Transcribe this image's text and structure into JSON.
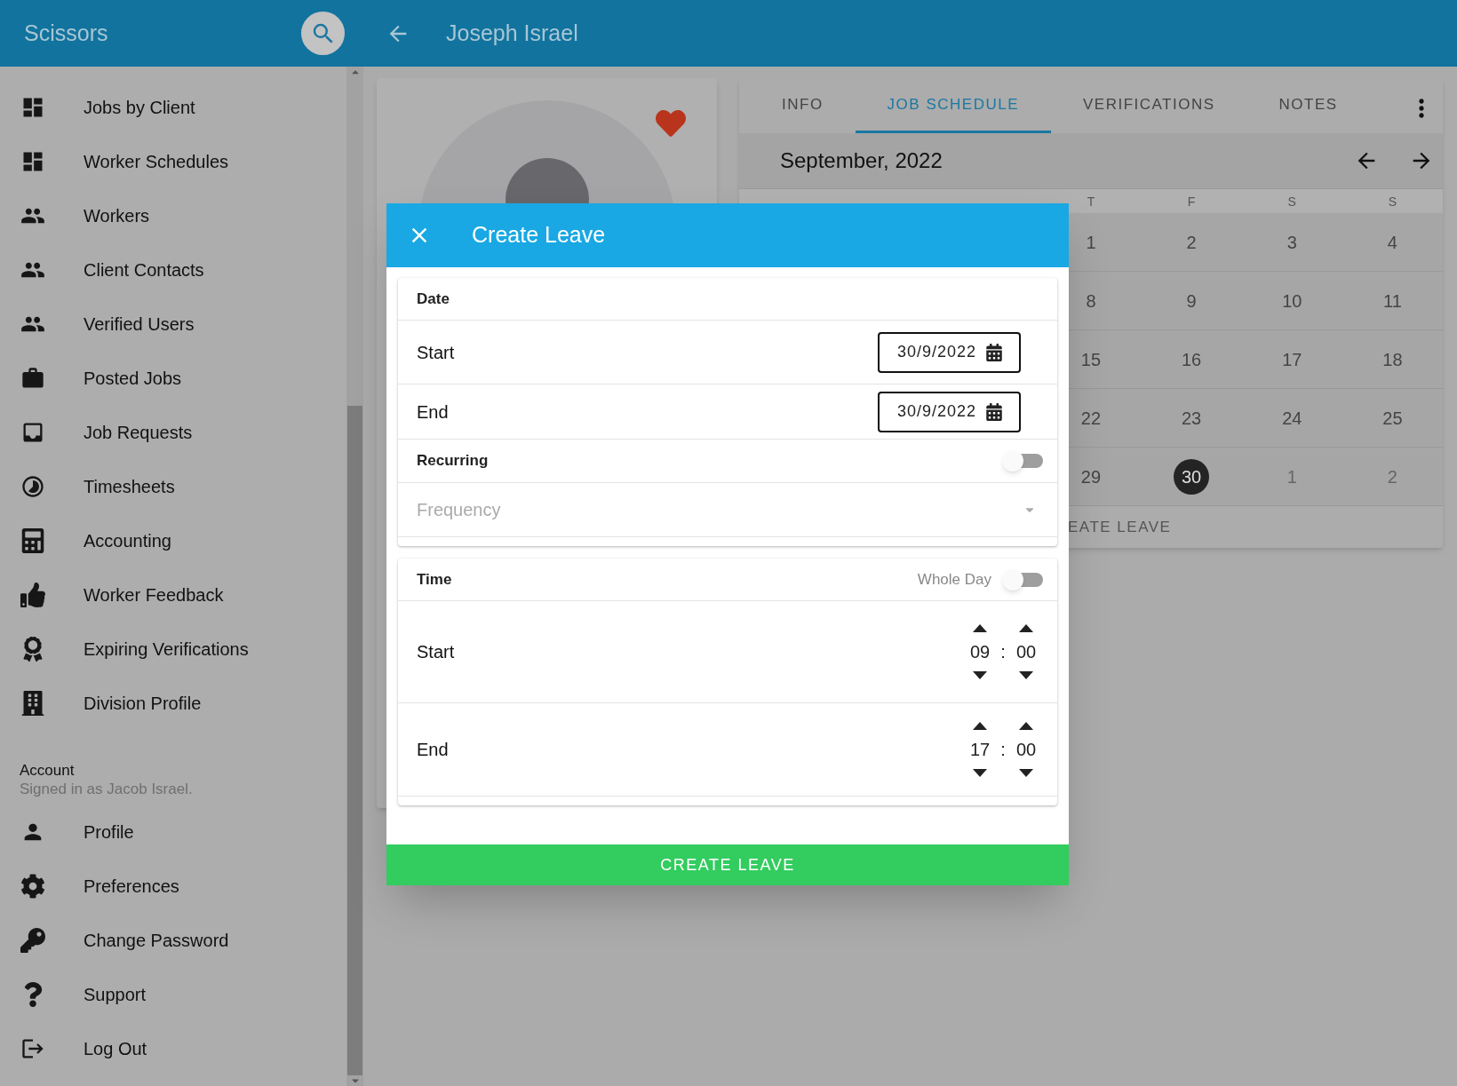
{
  "app_bar": {
    "title": "Scissors",
    "page_title": "Joseph Israel"
  },
  "sidebar": {
    "items": [
      {
        "label": "Jobs by Client"
      },
      {
        "label": "Worker Schedules"
      },
      {
        "label": "Workers"
      },
      {
        "label": "Client Contacts"
      },
      {
        "label": "Verified Users"
      },
      {
        "label": "Posted Jobs"
      },
      {
        "label": "Job Requests"
      },
      {
        "label": "Timesheets"
      },
      {
        "label": "Accounting"
      },
      {
        "label": "Worker Feedback"
      },
      {
        "label": "Expiring Verifications"
      },
      {
        "label": "Division Profile"
      }
    ],
    "account": {
      "heading": "Account",
      "subtitle": "Signed in as Jacob Israel."
    },
    "account_items": [
      {
        "label": "Profile"
      },
      {
        "label": "Preferences"
      },
      {
        "label": "Change Password"
      },
      {
        "label": "Support"
      },
      {
        "label": "Log Out"
      }
    ]
  },
  "profile_card": {
    "favorite": true
  },
  "tabs": [
    {
      "label": "INFO",
      "selected": false
    },
    {
      "label": "JOB SCHEDULE",
      "selected": true
    },
    {
      "label": "VERIFICATIONS",
      "selected": false
    },
    {
      "label": "NOTES",
      "selected": false
    }
  ],
  "calendar": {
    "month": "September, 2022",
    "weekdays": [
      "T",
      "F",
      "S",
      "S"
    ],
    "weeks": [
      [
        {
          "day": "1",
          "selected": false
        },
        {
          "day": "2",
          "selected": false
        },
        {
          "day": "3",
          "selected": false
        },
        {
          "day": "4",
          "selected": false
        }
      ],
      [
        {
          "day": "8",
          "selected": false
        },
        {
          "day": "9",
          "selected": false
        },
        {
          "day": "10",
          "selected": false
        },
        {
          "day": "11",
          "selected": false
        }
      ],
      [
        {
          "day": "15",
          "selected": false
        },
        {
          "day": "16",
          "selected": false
        },
        {
          "day": "17",
          "selected": false
        },
        {
          "day": "18",
          "selected": false
        }
      ],
      [
        {
          "day": "22",
          "selected": false
        },
        {
          "day": "23",
          "selected": false
        },
        {
          "day": "24",
          "selected": false
        },
        {
          "day": "25",
          "selected": false
        }
      ],
      [
        {
          "day": "29",
          "selected": false
        },
        {
          "day": "30",
          "selected": true
        },
        {
          "day": "1",
          "selected": false
        },
        {
          "day": "2",
          "selected": false
        }
      ]
    ],
    "footer_action": "EATE LEAVE"
  },
  "dialog": {
    "title": "Create Leave",
    "date_section": {
      "heading": "Date",
      "start": {
        "label": "Start",
        "value": "30/9/2022"
      },
      "end": {
        "label": "End",
        "value": "30/9/2022"
      }
    },
    "recurring": {
      "label": "Recurring",
      "on": false
    },
    "frequency": {
      "placeholder": "Frequency"
    },
    "time_section": {
      "heading": "Time",
      "whole_day": {
        "label": "Whole Day",
        "on": false
      },
      "start": {
        "label": "Start",
        "hour": "09",
        "separator": ":",
        "minute": "00"
      },
      "end": {
        "label": "End",
        "hour": "17",
        "separator": ":",
        "minute": "00"
      }
    },
    "submit": "CREATE LEAVE"
  }
}
